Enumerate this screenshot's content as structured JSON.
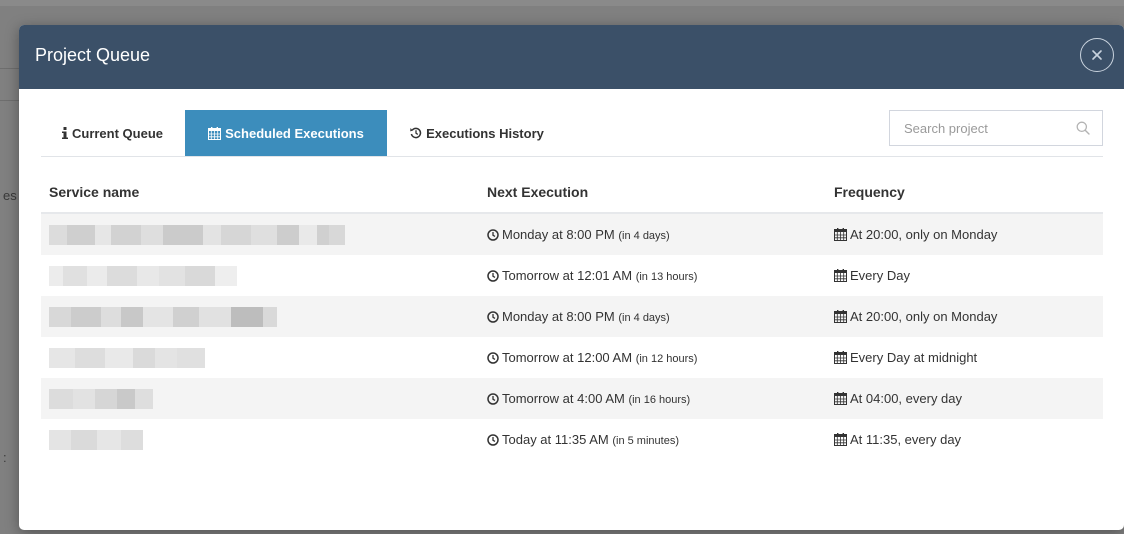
{
  "modal": {
    "title": "Project Queue"
  },
  "tabs": [
    {
      "label": "Current Queue",
      "icon": "info-icon",
      "active": false
    },
    {
      "label": "Scheduled Executions",
      "icon": "calendar-icon",
      "active": true
    },
    {
      "label": "Executions History",
      "icon": "history-icon",
      "active": false
    }
  ],
  "search": {
    "placeholder": "Search project",
    "value": ""
  },
  "table": {
    "headers": [
      "Service name",
      "Next Execution",
      "Frequency"
    ],
    "rows": [
      {
        "service": "",
        "next": "Monday at 8:00 PM",
        "relative": "(in 4 days)",
        "frequency": "At 20:00, only on Monday"
      },
      {
        "service": "",
        "next": "Tomorrow at 12:01 AM",
        "relative": "(in 13 hours)",
        "frequency": "Every Day"
      },
      {
        "service": "",
        "next": "Monday at 8:00 PM",
        "relative": "(in 4 days)",
        "frequency": "At 20:00, only on Monday"
      },
      {
        "service": "",
        "next": "Tomorrow at 12:00 AM",
        "relative": "(in 12 hours)",
        "frequency": "Every Day at midnight"
      },
      {
        "service": "",
        "next": "Tomorrow at 4:00 AM",
        "relative": "(in 16 hours)",
        "frequency": "At 04:00, every day"
      },
      {
        "service": "",
        "next": "Today at 11:35 AM",
        "relative": "(in 5 minutes)",
        "frequency": "At 11:35, every day"
      }
    ]
  },
  "background": {
    "fragment_1": "es",
    "fragment_2": ":"
  },
  "colors": {
    "header_bg": "#3b5068",
    "active_tab_bg": "#3c8dbc",
    "overlay": "#808080"
  }
}
